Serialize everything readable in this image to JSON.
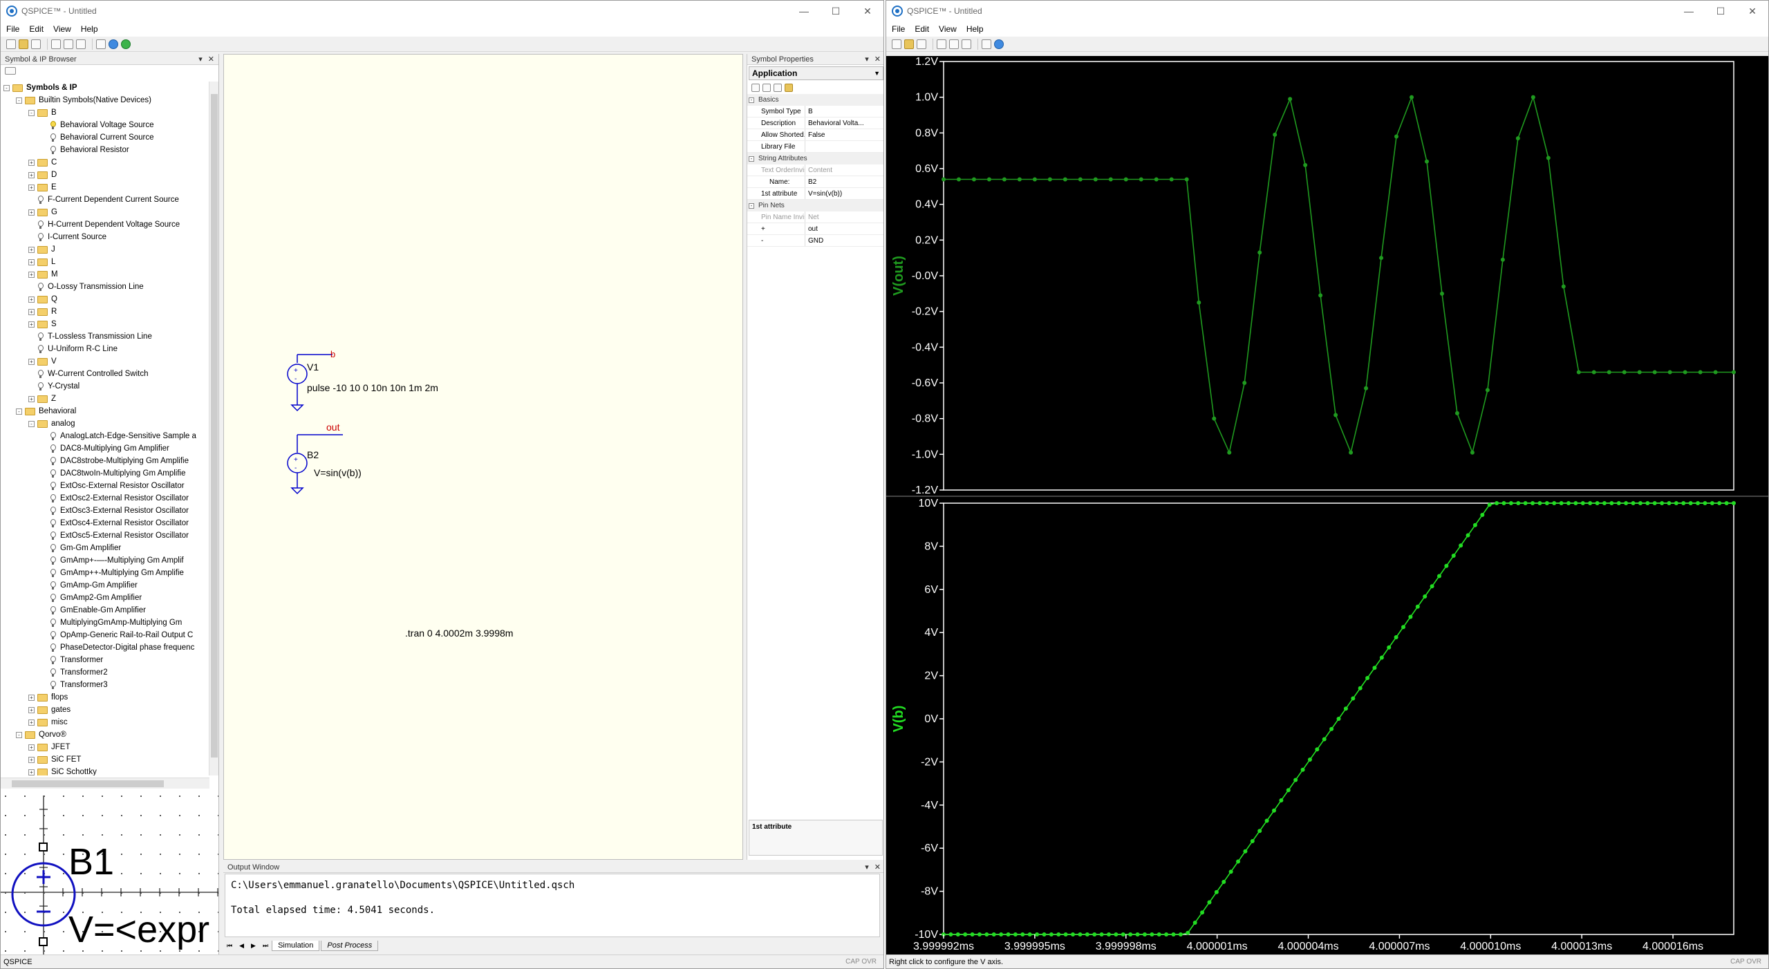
{
  "left_window": {
    "title": "QSPICE™ - Untitled",
    "menu": [
      "File",
      "Edit",
      "View",
      "Help"
    ],
    "controls": {
      "minimize": "—",
      "maximize": "☐",
      "close": "✕"
    },
    "browser": {
      "title": "Symbol & IP Browser",
      "tree": [
        {
          "label": "Symbols & IP",
          "level": 0,
          "kind": "folder",
          "exp": "-",
          "bold": true
        },
        {
          "label": "Builtin Symbols(Native Devices)",
          "level": 1,
          "kind": "folder",
          "exp": "-"
        },
        {
          "label": "B",
          "level": 2,
          "kind": "folder",
          "exp": "-"
        },
        {
          "label": "Behavioral Voltage Source",
          "level": 3,
          "kind": "bulb-yellow"
        },
        {
          "label": "Behavioral Current Source",
          "level": 3,
          "kind": "bulb"
        },
        {
          "label": "Behavioral Resistor",
          "level": 3,
          "kind": "bulb"
        },
        {
          "label": "C",
          "level": 2,
          "kind": "folder",
          "exp": "+"
        },
        {
          "label": "D",
          "level": 2,
          "kind": "folder",
          "exp": "+"
        },
        {
          "label": "E",
          "level": 2,
          "kind": "folder",
          "exp": "+"
        },
        {
          "label": "F-Current Dependent Current Source",
          "level": 2,
          "kind": "bulb"
        },
        {
          "label": "G",
          "level": 2,
          "kind": "folder",
          "exp": "+"
        },
        {
          "label": "H-Current Dependent Voltage Source",
          "level": 2,
          "kind": "bulb"
        },
        {
          "label": "I-Current Source",
          "level": 2,
          "kind": "bulb"
        },
        {
          "label": "J",
          "level": 2,
          "kind": "folder",
          "exp": "+"
        },
        {
          "label": "L",
          "level": 2,
          "kind": "folder",
          "exp": "+"
        },
        {
          "label": "M",
          "level": 2,
          "kind": "folder",
          "exp": "+"
        },
        {
          "label": "O-Lossy Transmission Line",
          "level": 2,
          "kind": "bulb"
        },
        {
          "label": "Q",
          "level": 2,
          "kind": "folder",
          "exp": "+"
        },
        {
          "label": "R",
          "level": 2,
          "kind": "folder",
          "exp": "+"
        },
        {
          "label": "S",
          "level": 2,
          "kind": "folder",
          "exp": "+"
        },
        {
          "label": "T-Lossless Transmission Line",
          "level": 2,
          "kind": "bulb"
        },
        {
          "label": "U-Uniform R-C Line",
          "level": 2,
          "kind": "bulb"
        },
        {
          "label": "V",
          "level": 2,
          "kind": "folder",
          "exp": "+"
        },
        {
          "label": "W-Current Controlled Switch",
          "level": 2,
          "kind": "bulb"
        },
        {
          "label": "Y-Crystal",
          "level": 2,
          "kind": "bulb"
        },
        {
          "label": "Z",
          "level": 2,
          "kind": "folder",
          "exp": "+"
        },
        {
          "label": "Behavioral",
          "level": 1,
          "kind": "folder",
          "exp": "-"
        },
        {
          "label": "analog",
          "level": 2,
          "kind": "folder",
          "exp": "-"
        },
        {
          "label": "AnalogLatch-Edge-Sensitive Sample a",
          "level": 3,
          "kind": "bulb"
        },
        {
          "label": "DAC8-Multiplying Gm Amplifier",
          "level": 3,
          "kind": "bulb"
        },
        {
          "label": "DAC8strobe-Multiplying Gm Amplifie",
          "level": 3,
          "kind": "bulb"
        },
        {
          "label": "DAC8twoIn-Multiplying Gm Amplifie",
          "level": 3,
          "kind": "bulb"
        },
        {
          "label": "ExtOsc-External Resistor Oscillator",
          "level": 3,
          "kind": "bulb"
        },
        {
          "label": "ExtOsc2-External Resistor Oscillator",
          "level": 3,
          "kind": "bulb"
        },
        {
          "label": "ExtOsc3-External Resistor Oscillator",
          "level": 3,
          "kind": "bulb"
        },
        {
          "label": "ExtOsc4-External Resistor Oscillator",
          "level": 3,
          "kind": "bulb"
        },
        {
          "label": "ExtOsc5-External Resistor Oscillator",
          "level": 3,
          "kind": "bulb"
        },
        {
          "label": "Gm-Gm Amplifier",
          "level": 3,
          "kind": "bulb"
        },
        {
          "label": "GmAmp+-—-Multiplying Gm Amplif",
          "level": 3,
          "kind": "bulb"
        },
        {
          "label": "GmAmp++-Multiplying Gm Amplifie",
          "level": 3,
          "kind": "bulb"
        },
        {
          "label": "GmAmp-Gm Amplifier",
          "level": 3,
          "kind": "bulb"
        },
        {
          "label": "GmAmp2-Gm Amplifier",
          "level": 3,
          "kind": "bulb"
        },
        {
          "label": "GmEnable-Gm Amplifier",
          "level": 3,
          "kind": "bulb"
        },
        {
          "label": "MultiplyingGmAmp-Multiplying Gm",
          "level": 3,
          "kind": "bulb"
        },
        {
          "label": "OpAmp-Generic Rail-to-Rail Output C",
          "level": 3,
          "kind": "bulb"
        },
        {
          "label": "PhaseDetector-Digital phase frequenc",
          "level": 3,
          "kind": "bulb"
        },
        {
          "label": "Transformer",
          "level": 3,
          "kind": "bulb"
        },
        {
          "label": "Transformer2",
          "level": 3,
          "kind": "bulb"
        },
        {
          "label": "Transformer3",
          "level": 3,
          "kind": "bulb"
        },
        {
          "label": "flops",
          "level": 2,
          "kind": "folder",
          "exp": "+"
        },
        {
          "label": "gates",
          "level": 2,
          "kind": "folder",
          "exp": "+"
        },
        {
          "label": "misc",
          "level": 2,
          "kind": "folder",
          "exp": "+"
        },
        {
          "label": "Qorvo®",
          "level": 1,
          "kind": "folder",
          "exp": "-"
        },
        {
          "label": "JFET",
          "level": 2,
          "kind": "folder",
          "exp": "+"
        },
        {
          "label": "SiC FET",
          "level": 2,
          "kind": "folder",
          "exp": "+"
        },
        {
          "label": "SiC Schottky",
          "level": 2,
          "kind": "folder",
          "exp": "+"
        }
      ]
    },
    "preview": {
      "name": "B1",
      "expr": "V=<expr"
    },
    "schematic": {
      "v1_name": "V1",
      "v1_value": "pulse -10 10 0 10n 10n 1m 2m",
      "v1_net": "b",
      "b2_name": "B2",
      "b2_value": "V=sin(v(b))",
      "b2_net": "out",
      "directive": ".tran 0 4.0002m 3.9998m"
    },
    "properties": {
      "title": "Symbol Properties",
      "application": "Application",
      "groups": [
        {
          "name": "Basics",
          "rows": [
            {
              "k": "Symbol Type",
              "v": "B"
            },
            {
              "k": "Description",
              "v": "Behavioral Volta..."
            },
            {
              "k": "Allow Shorted...",
              "v": "False"
            },
            {
              "k": "Library File",
              "v": ""
            }
          ]
        },
        {
          "name": "String Attributes",
          "rows": [
            {
              "k": "Text OrderInvis.",
              "v": "Content",
              "grey": true
            },
            {
              "k": "Name:",
              "v": "B2",
              "indent": true
            },
            {
              "k": "1st attribute",
              "v": "V=sin(v(b))"
            }
          ]
        },
        {
          "name": "Pin Nets",
          "rows": [
            {
              "k": "Pin Name Invis.",
              "v": "Net",
              "grey": true
            },
            {
              "k": "+",
              "v": "out"
            },
            {
              "k": "-",
              "v": "GND"
            }
          ]
        }
      ],
      "description_box": "1st attribute"
    },
    "output": {
      "title": "Output Window",
      "lines": [
        "C:\\Users\\emmanuel.granatello\\Documents\\QSPICE\\Untitled.qsch",
        "Total elapsed time: 4.5041 seconds."
      ],
      "tabs": [
        "Simulation",
        "Post Process"
      ]
    },
    "status": {
      "left": "QSPICE",
      "right": "CAP OVR"
    }
  },
  "right_window": {
    "title": "QSPICE™ - Untitled",
    "menu": [
      "File",
      "Edit",
      "View",
      "Help"
    ],
    "controls": {
      "minimize": "—",
      "maximize": "☐",
      "close": "✕"
    },
    "status": {
      "left": "Right click to configure the V axis.",
      "right": "CAP OVR"
    }
  },
  "colors": {
    "trace_out": "#1f9a1f",
    "trace_b": "#22dd22",
    "axis": "#ffffff",
    "plot_bg": "#000000",
    "schematic_bg": "#fffff0",
    "wire": "#0000cc",
    "net_label": "#cc0000"
  },
  "chart_data": [
    {
      "type": "line",
      "ylabel": "V(out)",
      "ylim": [
        -1.2,
        1.2
      ],
      "yticks": [
        "1.2V",
        "1.0V",
        "0.8V",
        "0.6V",
        "0.4V",
        "0.2V",
        "-0.0V",
        "-0.2V",
        "-0.4V",
        "-0.6V",
        "-0.8V",
        "-1.0V",
        "-1.2V"
      ],
      "xlim": [
        3.999992,
        4.000018
      ],
      "x": [
        3.999992,
        3.9999925,
        3.999993,
        3.9999935,
        3.999994,
        3.9999945,
        3.999995,
        3.9999955,
        3.999996,
        3.9999965,
        3.999997,
        3.9999975,
        3.999998,
        3.9999985,
        3.999999,
        3.9999995,
        4.0,
        4.0000004,
        4.0000009,
        4.0000014,
        4.0000019,
        4.0000024,
        4.0000029,
        4.0000034,
        4.0000039,
        4.0000044,
        4.0000049,
        4.0000054,
        4.0000059,
        4.0000064,
        4.0000069,
        4.0000074,
        4.0000079,
        4.0000084,
        4.0000089,
        4.0000094,
        4.0000099,
        4.0000104,
        4.0000109,
        4.0000114,
        4.0000119,
        4.0000124,
        4.0000129,
        4.0000134,
        4.0000139,
        4.0000144,
        4.0000149,
        4.0000154,
        4.0000159,
        4.0000164,
        4.0000169,
        4.0000174,
        4.000018
      ],
      "values": [
        0.54,
        0.54,
        0.54,
        0.54,
        0.54,
        0.54,
        0.54,
        0.54,
        0.54,
        0.54,
        0.54,
        0.54,
        0.54,
        0.54,
        0.54,
        0.54,
        0.54,
        -0.15,
        -0.8,
        -0.99,
        -0.6,
        0.13,
        0.79,
        0.99,
        0.62,
        -0.11,
        -0.78,
        -0.99,
        -0.63,
        0.1,
        0.78,
        1.0,
        0.64,
        -0.1,
        -0.77,
        -0.99,
        -0.64,
        0.09,
        0.77,
        1.0,
        0.66,
        -0.06,
        -0.54,
        -0.54,
        -0.54,
        -0.54,
        -0.54,
        -0.54,
        -0.54,
        -0.54,
        -0.54,
        -0.54,
        -0.54
      ]
    },
    {
      "type": "line",
      "ylabel": "V(b)",
      "ylim": [
        -10,
        10
      ],
      "yticks": [
        "10V",
        "8V",
        "6V",
        "4V",
        "2V",
        "0V",
        "-2V",
        "-4V",
        "-6V",
        "-8V",
        "-10V"
      ],
      "xlim": [
        3.999992,
        4.000018
      ],
      "xticks": [
        "3.999992ms",
        "3.999995ms",
        "3.999998ms",
        "4.000001ms",
        "4.000004ms",
        "4.000007ms",
        "4.000010ms",
        "4.000013ms",
        "4.000016ms"
      ],
      "x": [
        3.999992,
        4.0,
        4.00001,
        4.000018
      ],
      "values": [
        -10,
        -10,
        10,
        10
      ]
    }
  ]
}
